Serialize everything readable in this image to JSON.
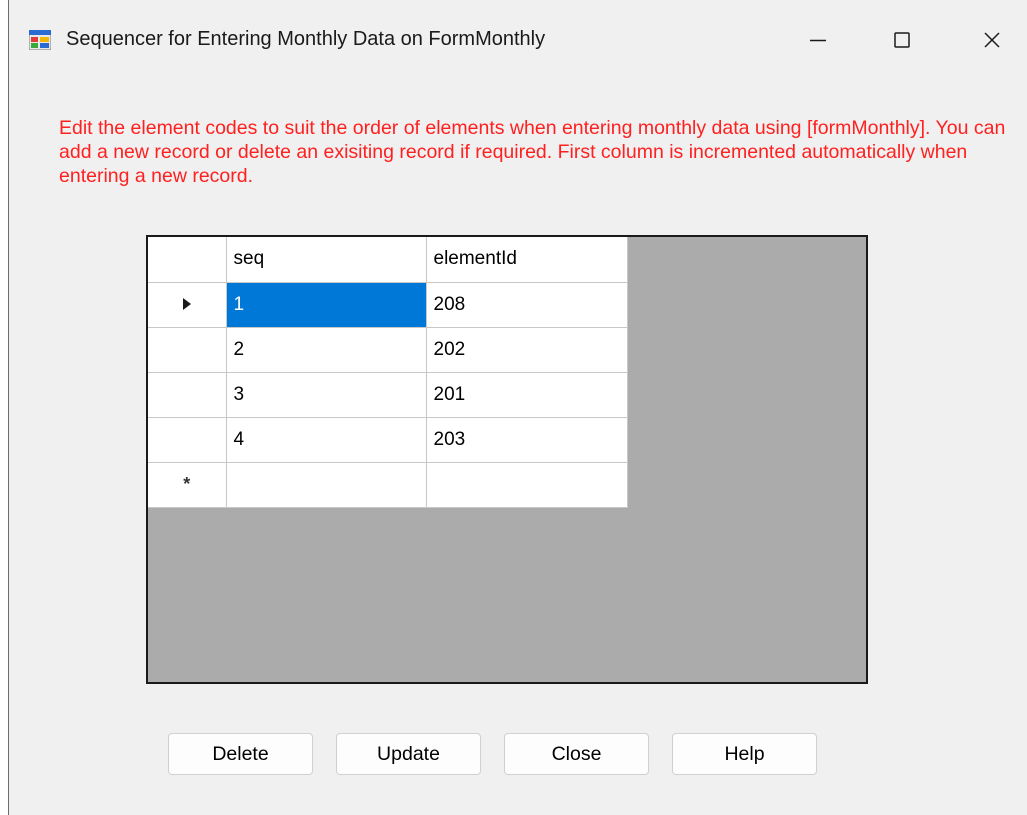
{
  "window": {
    "title": "Sequencer for Entering Monthly Data on FormMonthly",
    "controls": {
      "minimize_icon": "minimize-icon",
      "maximize_icon": "maximize-icon",
      "close_icon": "close-icon"
    }
  },
  "instructions": "Edit the element codes  to suit the order of elements when entering monthly data using [formMonthly]. You can add a new record or delete an exisiting record if required. First column is incremented automatically when entering a new record.",
  "grid": {
    "columns": [
      "seq",
      "elementId"
    ],
    "rows": [
      {
        "seq": "1",
        "elementId": "208",
        "current": true,
        "selected_cell": "seq"
      },
      {
        "seq": "2",
        "elementId": "202"
      },
      {
        "seq": "3",
        "elementId": "201"
      },
      {
        "seq": "4",
        "elementId": "203"
      }
    ],
    "new_row_marker": "*",
    "selection_color": "#0078d7"
  },
  "buttons": {
    "delete": "Delete",
    "update": "Update",
    "close": "Close",
    "help": "Help"
  },
  "colors": {
    "instruction_text": "#ff2020",
    "grid_background": "#ababab"
  }
}
